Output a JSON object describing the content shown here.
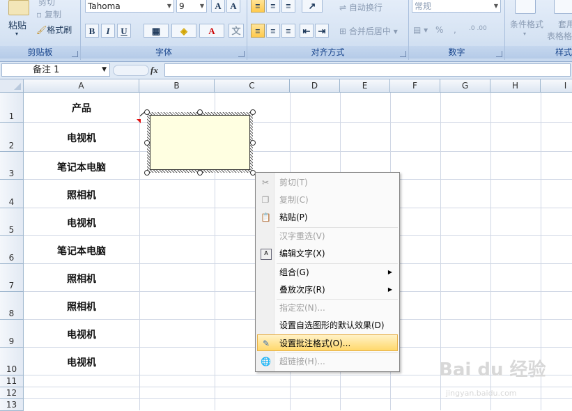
{
  "ribbon": {
    "clipboard": {
      "paste": "粘贴",
      "cut": "剪切",
      "copy": "复制",
      "format_painter": "格式刷",
      "label": "剪贴板"
    },
    "font": {
      "name": "Tahoma",
      "size": "9",
      "bold": "B",
      "italic": "I",
      "underline": "U",
      "label": "字体"
    },
    "alignment": {
      "wrap": "自动换行",
      "merge": "合并后居中",
      "label": "对齐方式"
    },
    "number": {
      "format": "常规",
      "label": "数字"
    },
    "styles": {
      "conditional": "条件格式",
      "table": "套用",
      "table2": "表格格",
      "label": "样式"
    }
  },
  "formula_bar": {
    "name_box": "备注 1",
    "fx": "fx",
    "content": ""
  },
  "columns": [
    "A",
    "B",
    "C",
    "D",
    "E",
    "F",
    "G",
    "H",
    "I"
  ],
  "rows": [
    "1",
    "2",
    "3",
    "4",
    "5",
    "6",
    "7",
    "8",
    "9",
    "10",
    "11",
    "12",
    "13"
  ],
  "cells_a": [
    "产品",
    "电视机",
    "笔记本电脑",
    "照相机",
    "电视机",
    "笔记本电脑",
    "照相机",
    "照相机",
    "电视机",
    "电视机"
  ],
  "context_menu": [
    {
      "label": "剪切(T)",
      "enabled": false,
      "icon": "scissors-icon"
    },
    {
      "label": "复制(C)",
      "enabled": false,
      "icon": "copy-icon"
    },
    {
      "label": "粘贴(P)",
      "enabled": true,
      "icon": "paste-icon"
    },
    {
      "label": "汉字重选(V)",
      "enabled": false,
      "icon": ""
    },
    {
      "label": "编辑文字(X)",
      "enabled": true,
      "icon": "edit-text-icon"
    },
    {
      "label": "组合(G)",
      "enabled": true,
      "icon": "",
      "submenu": true
    },
    {
      "label": "叠放次序(R)",
      "enabled": true,
      "icon": "",
      "submenu": true
    },
    {
      "label": "指定宏(N)...",
      "enabled": false,
      "icon": ""
    },
    {
      "label": "设置自选图形的默认效果(D)",
      "enabled": true,
      "icon": ""
    },
    {
      "label": "设置批注格式(O)...",
      "enabled": true,
      "icon": "format-comment-icon",
      "highlighted": true
    },
    {
      "label": "超链接(H)...",
      "enabled": false,
      "icon": "hyperlink-icon"
    }
  ],
  "watermark": {
    "text": "Bai du 经验",
    "sub": "jingyan.baidu.com"
  }
}
